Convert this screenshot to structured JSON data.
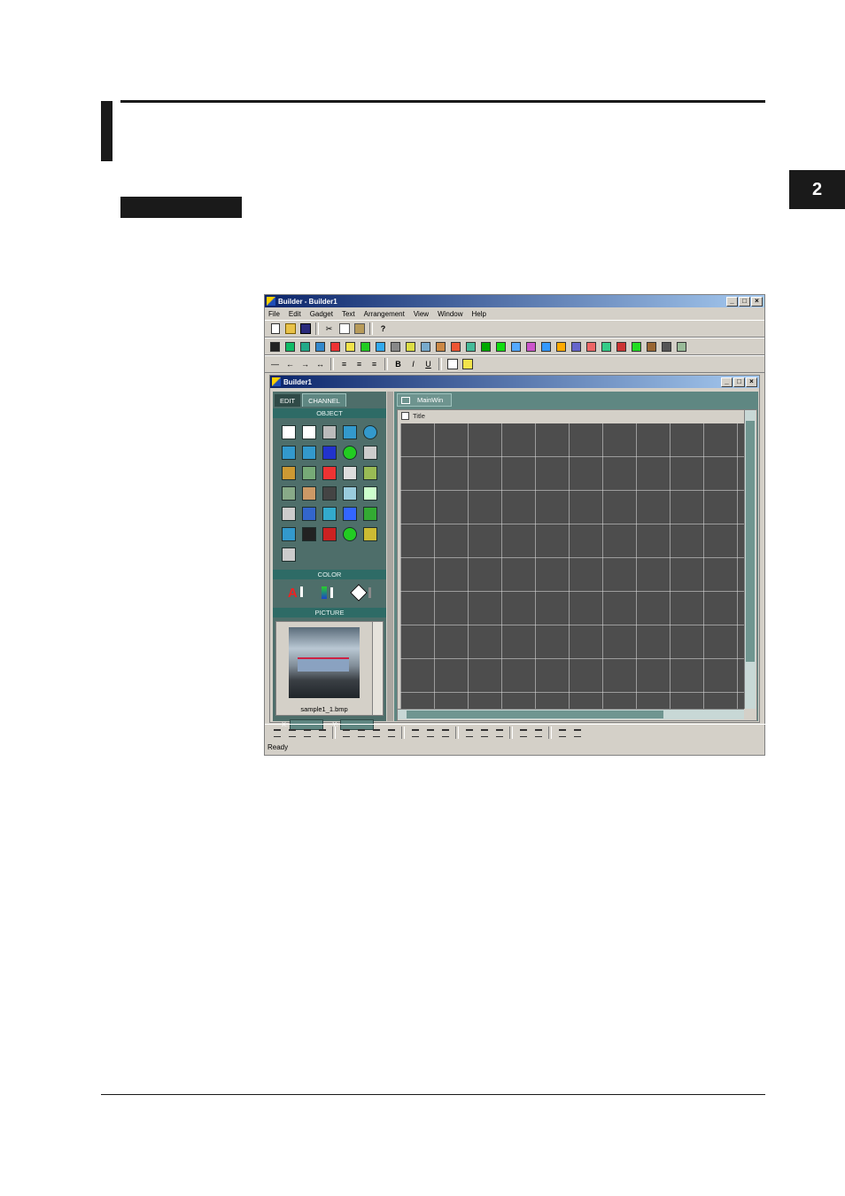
{
  "page": {
    "chapter_tab": "2"
  },
  "app": {
    "title": "Builder - Builder1",
    "window_buttons": [
      "_",
      "□",
      "×"
    ],
    "menu": [
      "File",
      "Edit",
      "Gadget",
      "Text",
      "Arrangement",
      "View",
      "Window",
      "Help"
    ],
    "toolbar1": [
      "new-icon",
      "open-icon",
      "save-icon",
      "|",
      "cut-icon",
      "copy-icon",
      "paste-icon",
      "|",
      "help-icon"
    ],
    "toolbar2_icons": [
      "pointer",
      "A",
      "line",
      "rect",
      "ellipse",
      "arc",
      "polygon",
      "bitmap",
      "circle-lamp",
      "digital",
      "bar",
      "meter",
      "trend",
      "numeric",
      "text-display",
      "chart",
      "graph",
      "grid",
      "image",
      "btn",
      "switch",
      "button",
      "color-button",
      "panel",
      "indicator",
      "alarm",
      "lamp",
      "table"
    ],
    "toolbar3_icons": [
      "line-style",
      "arrow-left",
      "arrow-right",
      "arrow-both",
      "|",
      "align-left",
      "align-center",
      "align-right",
      "|",
      "B",
      "I",
      "U",
      "|",
      "front",
      "back"
    ],
    "status": "Ready"
  },
  "inner": {
    "title": "Builder1",
    "window_buttons": [
      "_",
      "□",
      "×"
    ],
    "tabs": [
      "EDIT",
      "CHANNEL"
    ],
    "sections": {
      "object": "OBJECT",
      "color": "COLOR",
      "picture": "PICTURE"
    },
    "object_icons": [
      "pointer",
      "text-A",
      "line",
      "rect",
      "ellipse",
      "quarter",
      "sector",
      "bitmap",
      "lamp",
      "digital",
      "bar",
      "meter",
      "thermo",
      "numeric",
      "bar-graph",
      "trend",
      "label",
      "wave",
      "arc-meter",
      "image",
      "btn",
      "multi-1",
      "multi-2",
      "multi-3",
      "rect-green",
      "display",
      "panel",
      "alarm",
      "lamp-green",
      "chart",
      "table"
    ],
    "picture_name": "sample1_1.bmp",
    "x_label": "X:",
    "y_label": "Y:",
    "doc_tab": "MainWin",
    "doc_title": "Title"
  },
  "colors": {
    "panel": "#4e6e6a",
    "section_header": "#2e6b66",
    "canvas": "#4d4d4d",
    "titlebar_start": "#0a246a",
    "titlebar_end": "#a6caf0"
  }
}
